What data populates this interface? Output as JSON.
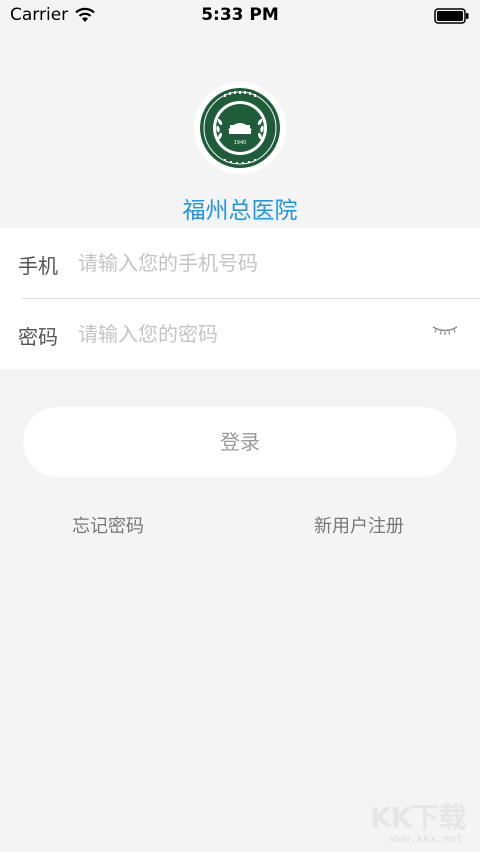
{
  "status_bar": {
    "carrier": "Carrier",
    "time": "5:33 PM"
  },
  "header": {
    "hospital_name": "福州总医院",
    "logo_year": "1940"
  },
  "form": {
    "phone_label": "手机",
    "phone_placeholder": "请输入您的手机号码",
    "password_label": "密码",
    "password_placeholder": "请输入您的密码"
  },
  "actions": {
    "login_label": "登录",
    "forgot_password": "忘记密码",
    "register": "新用户注册"
  },
  "watermark": {
    "text": "KK下载",
    "url": "www.kkx.net"
  },
  "colors": {
    "accent": "#2196e6",
    "background": "#f4f4f4",
    "logo_green": "#1e5c3a"
  }
}
